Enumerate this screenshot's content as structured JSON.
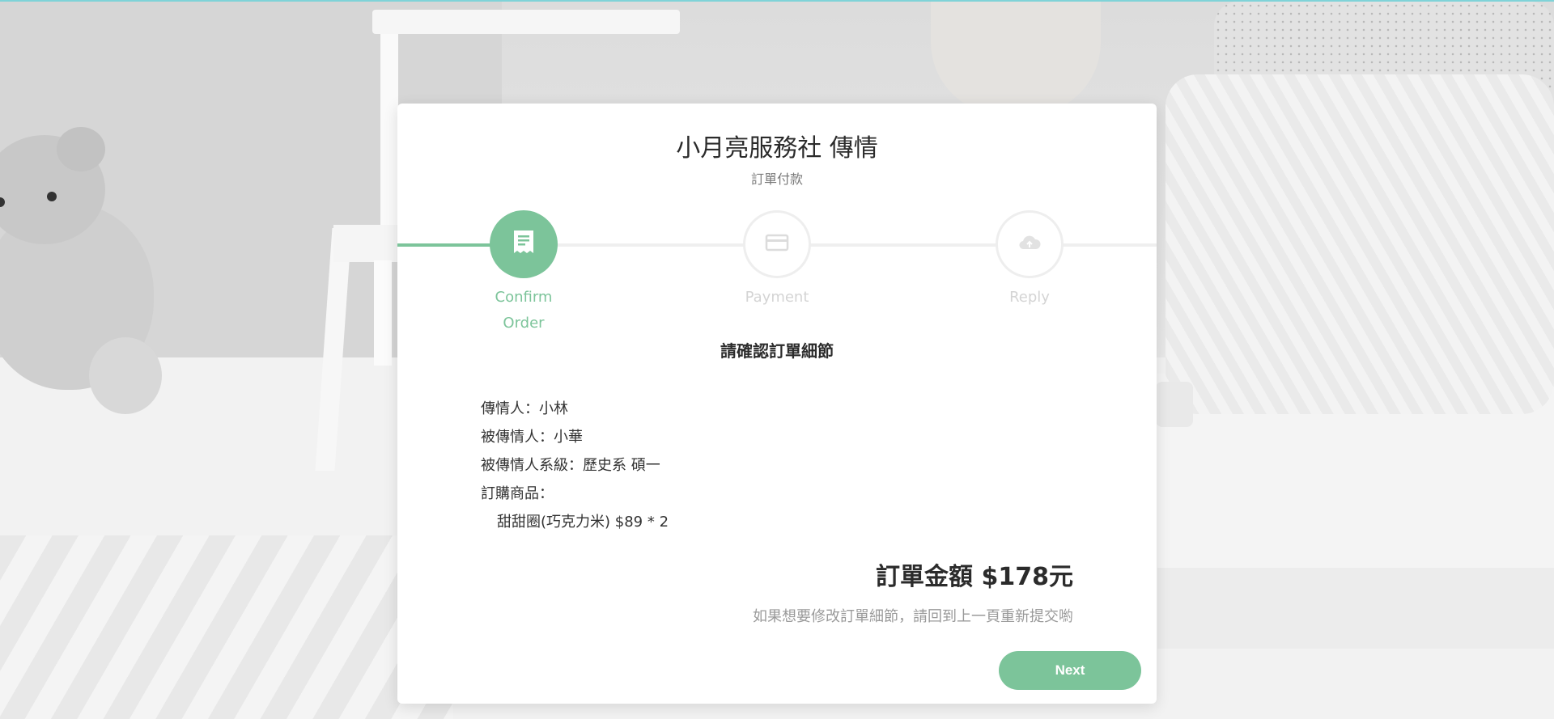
{
  "header": {
    "title": "小月亮服務社 傳情",
    "subtitle": "訂單付款"
  },
  "steps": [
    {
      "line1": "Confirm",
      "line2": "Order",
      "icon": "receipt-icon",
      "state": "active"
    },
    {
      "line1": "Payment",
      "icon": "credit-card-icon",
      "state": "inactive"
    },
    {
      "line1": "Reply",
      "icon": "cloud-upload-icon",
      "state": "inactive"
    }
  ],
  "progress": {
    "completed_fraction": 0.17
  },
  "order": {
    "section_title": "請確認訂單細節",
    "sender": "傳情人：小林",
    "recipient": "被傳情人：小華",
    "recipient_dept": "被傳情人系級：歷史系 碩一",
    "items_label": "訂購商品：",
    "items": [
      "甜甜圈(巧克力米) $89 * 2"
    ],
    "total": "訂單金額 $178元",
    "note": "如果想要修改訂單細節，請回到上一頁重新提交喲"
  },
  "buttons": {
    "next": "Next"
  },
  "colors": {
    "accent": "#7cc49a",
    "inactive": "#d4d4d4",
    "top_strip": "#7fd3d8"
  }
}
